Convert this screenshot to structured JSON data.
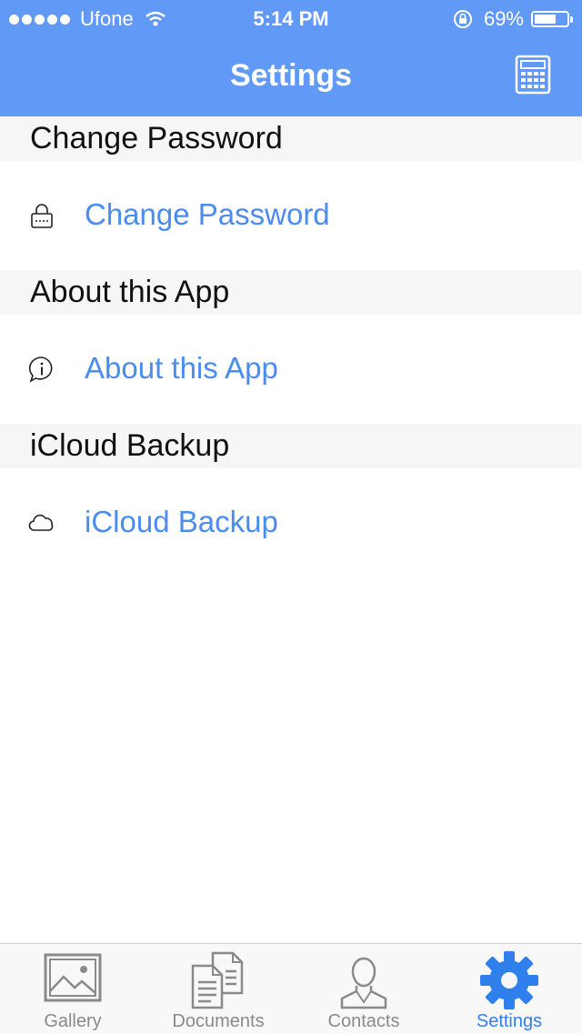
{
  "status_bar": {
    "carrier": "Ufone",
    "time": "5:14 PM",
    "battery_text": "69%",
    "battery_level": 0.69
  },
  "nav": {
    "title": "Settings",
    "right_icon": "calculator-icon"
  },
  "sections": [
    {
      "header": "Change Password",
      "row_label": "Change Password",
      "icon": "lock-icon"
    },
    {
      "header": "About this App",
      "row_label": "About this App",
      "icon": "info-icon"
    },
    {
      "header": "iCloud Backup",
      "row_label": "iCloud Backup",
      "icon": "cloud-icon"
    }
  ],
  "tabs": [
    {
      "label": "Gallery",
      "icon": "gallery-icon"
    },
    {
      "label": "Documents",
      "icon": "documents-icon"
    },
    {
      "label": "Contacts",
      "icon": "contacts-icon"
    },
    {
      "label": "Settings",
      "icon": "gear-icon",
      "active": true
    }
  ],
  "colors": {
    "accent": "#6199f7",
    "link": "#4a8cf0",
    "tab_active": "#2f80ed",
    "tab_inactive": "#8a8a8a"
  }
}
